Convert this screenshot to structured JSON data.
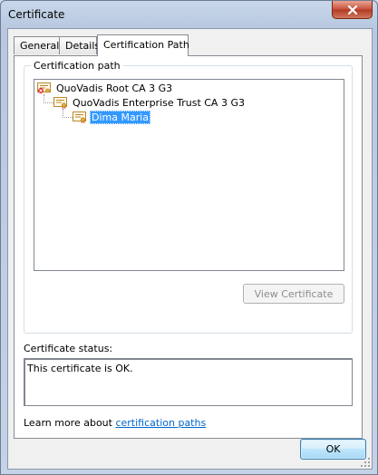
{
  "window": {
    "title": "Certificate"
  },
  "tabs": [
    {
      "label": "General",
      "active": false
    },
    {
      "label": "Details",
      "active": false
    },
    {
      "label": "Certification Path",
      "active": true
    }
  ],
  "certification_path": {
    "group_label": "Certification path",
    "nodes": [
      {
        "label": "QuoVadis Root CA 3 G3",
        "level": 0,
        "selected": false,
        "icon": "root-certificate-icon"
      },
      {
        "label": "QuoVadis Enterprise Trust CA 3 G3",
        "level": 1,
        "selected": false,
        "icon": "certificate-icon"
      },
      {
        "label": "Dima Maria",
        "level": 2,
        "selected": true,
        "icon": "certificate-icon"
      }
    ],
    "view_button_label": "View Certificate"
  },
  "status": {
    "label": "Certificate status:",
    "text": "This certificate is OK."
  },
  "learn_more": {
    "prefix": "Learn more about ",
    "link_text": "certification paths"
  },
  "ok_label": "OK",
  "colors": {
    "selection": "#3399ff",
    "link": "#0066cc",
    "close_button": "#c7503a"
  }
}
